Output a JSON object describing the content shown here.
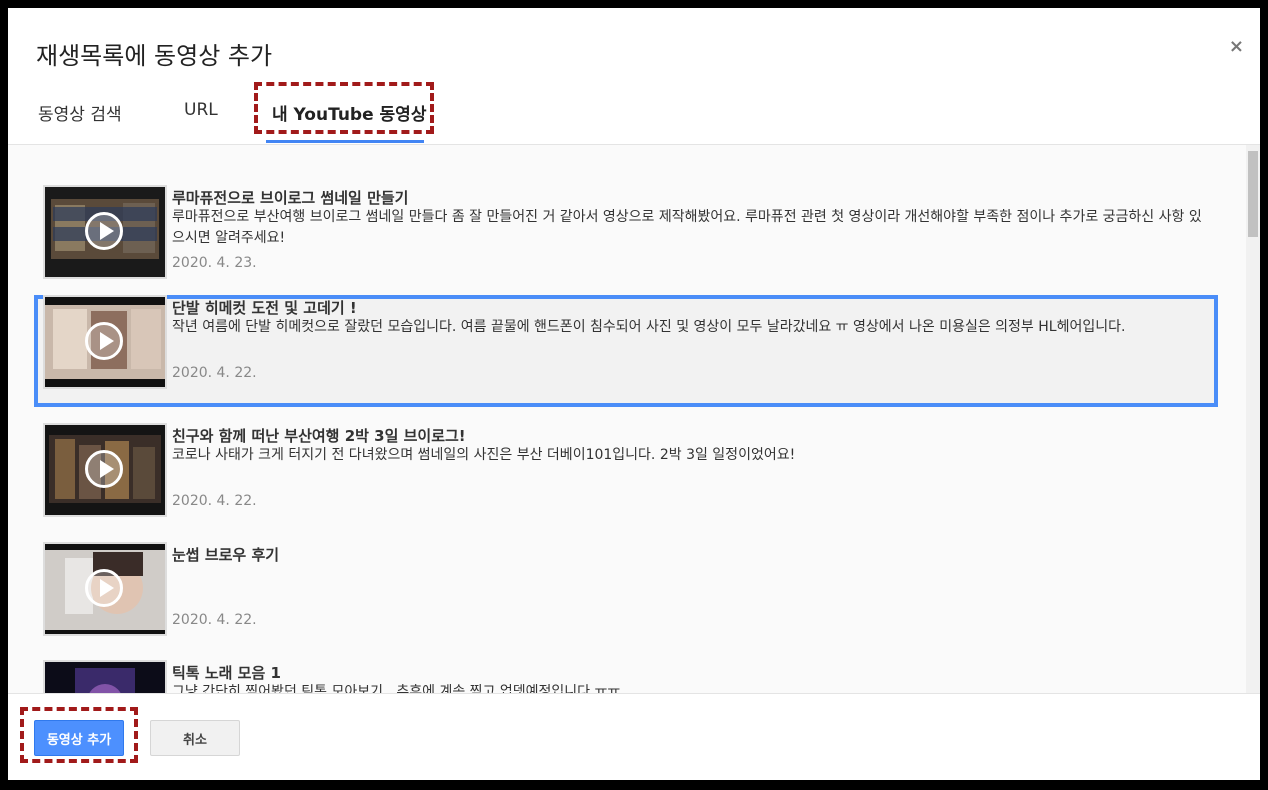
{
  "dialog": {
    "title": "재생목록에 동영상 추가",
    "close_icon": "×"
  },
  "tabs": [
    {
      "label": "동영상 검색",
      "active": false
    },
    {
      "label": "URL",
      "active": false
    },
    {
      "label": "내 YouTube 동영상",
      "active": true
    }
  ],
  "videos": [
    {
      "title": "루마퓨전으로 브이로그 썸네일 만들기",
      "description": "루마퓨전으로 부산여행 브이로그 썸네일 만들다 좀 잘 만들어진 거 같아서 영상으로 제작해봤어요. 루마퓨전 관련 첫 영상이라 개선해야할 부족한 점이나 추가로 궁금하신 사항 있으시면 알려주세요!",
      "date": "2020. 4. 23.",
      "selected": false
    },
    {
      "title": "단발 히메컷 도전 및 고데기 !",
      "description": "작년 여름에 단발 히메컷으로 잘랐던 모습입니다. 여름 끝물에 핸드폰이 침수되어 사진 및 영상이 모두 날라갔네요 ㅠ 영상에서 나온 미용실은 의정부 HL헤어입니다.",
      "date": "2020. 4. 22.",
      "selected": true
    },
    {
      "title": "친구와 함께 떠난 부산여행 2박 3일 브이로그!",
      "description": "코로나 사태가 크게 터지기 전 다녀왔으며 썸네일의 사진은 부산 더베이101입니다. 2박 3일 일정이었어요!",
      "date": "2020. 4. 22.",
      "selected": false
    },
    {
      "title": "눈썹 브로우 후기",
      "description": "",
      "date": "2020. 4. 22.",
      "selected": false
    },
    {
      "title": "틱톡 노래 모음 1",
      "description": "그냥 간단히 찍어봤던 틱톡 모아보기.. 추후에 계속 찍고 업뎃예정입니다 ㅠㅠ",
      "date": "",
      "selected": false
    }
  ],
  "footer": {
    "add_label": "동영상 추가",
    "cancel_label": "취소"
  },
  "colors": {
    "accent": "#4285f4",
    "selected_border": "#4a8df8",
    "primary_button": "#4d90fe",
    "highlight_dash": "#a11a1a"
  }
}
